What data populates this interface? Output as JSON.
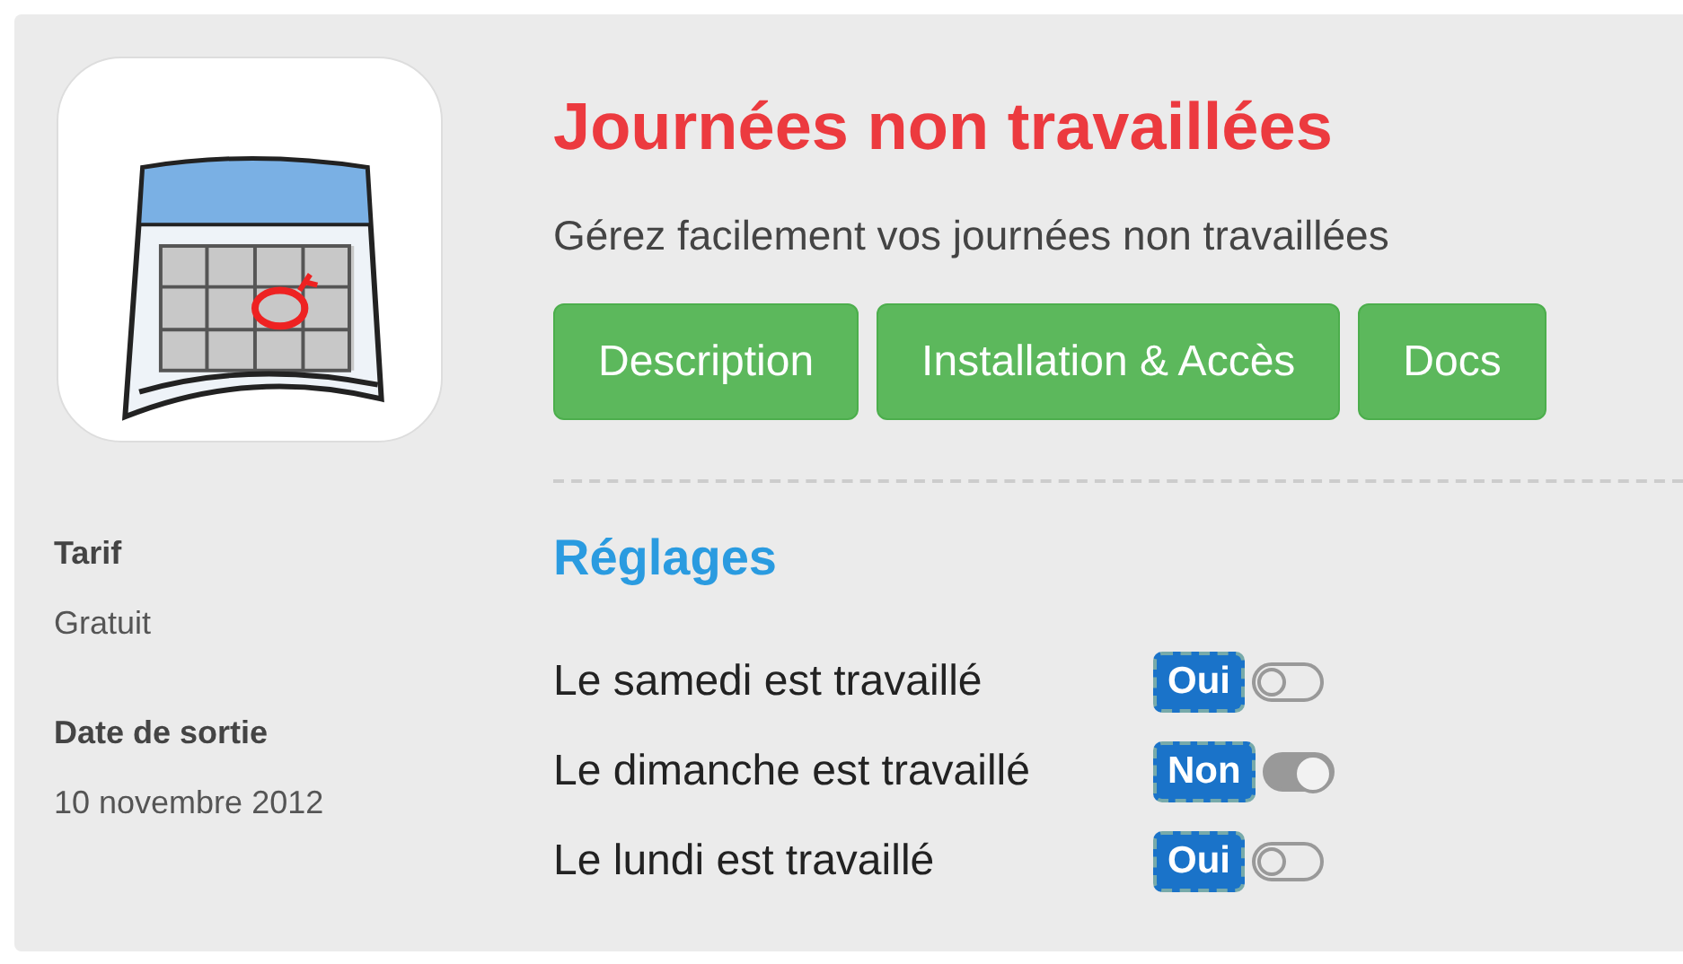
{
  "app": {
    "title": "Journées non travaillées",
    "subtitle": "Gérez facilement vos journées non travaillées"
  },
  "buttons": [
    "Description",
    "Installation & Accès",
    "Docs"
  ],
  "info": [
    {
      "label": "Tarif",
      "value": "Gratuit"
    },
    {
      "label": "Date de sortie",
      "value": "10 novembre 2012"
    }
  ],
  "settings": {
    "heading": "Réglages",
    "rows": [
      {
        "label": "Le samedi est travaillé",
        "badge": "Oui",
        "on": false
      },
      {
        "label": "Le dimanche est travaillé",
        "badge": "Non",
        "on": true
      },
      {
        "label": "Le lundi est travaillé",
        "badge": "Oui",
        "on": false
      }
    ]
  }
}
